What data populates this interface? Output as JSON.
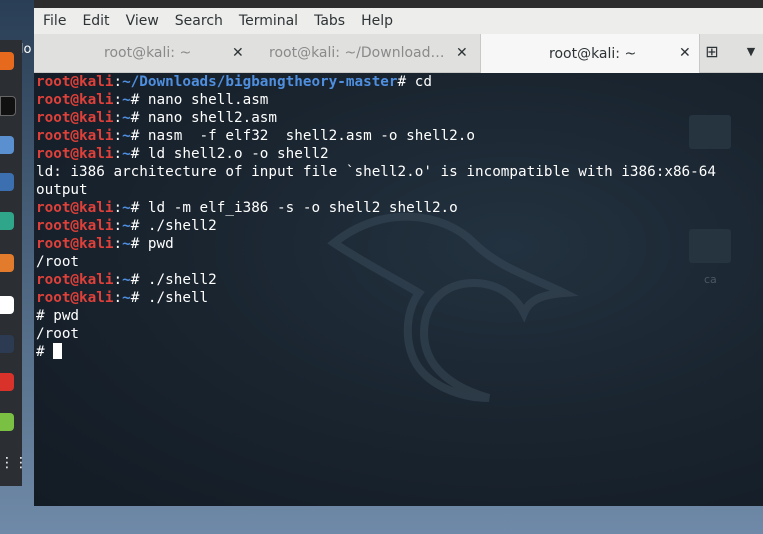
{
  "desktop": {
    "label": "hello"
  },
  "menubar": {
    "items": [
      "File",
      "Edit",
      "View",
      "Search",
      "Terminal",
      "Tabs",
      "Help"
    ]
  },
  "tabs": [
    {
      "label": "root@kali: ~",
      "active": false
    },
    {
      "label": "root@kali: ~/Downloads...",
      "active": false
    },
    {
      "label": "root@kali: ~",
      "active": true
    }
  ],
  "tab_close_symbol": "✕",
  "new_tab_symbol": "⊞",
  "tab_menu_symbol": "▼",
  "terminal": {
    "folder_label": "ca",
    "lines": [
      {
        "user": "root@kali",
        "sep": ":",
        "path": "~/Downloads/bigbangtheory-master",
        "cmd": "# cd"
      },
      {
        "user": "root@kali",
        "sep": ":",
        "path": "~",
        "cmd": "# nano shell.asm"
      },
      {
        "user": "root@kali",
        "sep": ":",
        "path": "~",
        "cmd": "# nano shell2.asm"
      },
      {
        "user": "root@kali",
        "sep": ":",
        "path": "~",
        "cmd": "# nasm  -f elf32  shell2.asm -o shell2.o"
      },
      {
        "user": "root@kali",
        "sep": ":",
        "path": "~",
        "cmd": "# ld shell2.o -o shell2"
      },
      {
        "text": "ld: i386 architecture of input file `shell2.o' is incompatible with i386:x86-64"
      },
      {
        "text": "output"
      },
      {
        "user": "root@kali",
        "sep": ":",
        "path": "~",
        "cmd": "# ld -m elf_i386 -s -o shell2 shell2.o"
      },
      {
        "user": "root@kali",
        "sep": ":",
        "path": "~",
        "cmd": "# ./shell2"
      },
      {
        "user": "root@kali",
        "sep": ":",
        "path": "~",
        "cmd": "# pwd"
      },
      {
        "text": "/root"
      },
      {
        "user": "root@kali",
        "sep": ":",
        "path": "~",
        "cmd": "# ./shell2"
      },
      {
        "user": "root@kali",
        "sep": ":",
        "path": "~",
        "cmd": "# ./shell"
      },
      {
        "text": "# pwd"
      },
      {
        "text": "/root"
      },
      {
        "text": "# ",
        "cursor": true
      }
    ]
  },
  "colors": {
    "user": "#e0403a",
    "path": "#4f8fdf",
    "terminal_bg": "#1a2530"
  }
}
